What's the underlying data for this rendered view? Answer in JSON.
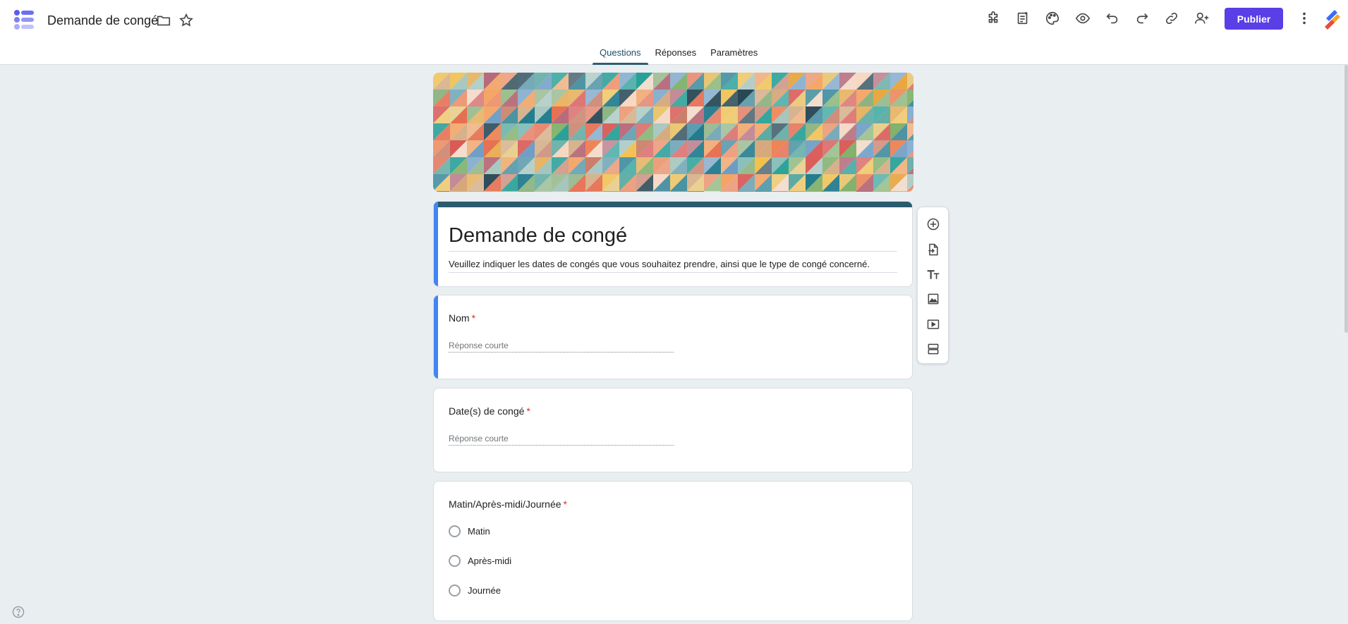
{
  "header": {
    "doc_title": "Demande de congé",
    "publish_label": "Publier"
  },
  "tabs": [
    {
      "label": "Questions",
      "active": true
    },
    {
      "label": "Réponses",
      "active": false
    },
    {
      "label": "Paramètres",
      "active": false
    }
  ],
  "form": {
    "title": "Demande de congé",
    "description": "Veuillez indiquer les dates de congés que vous souhaitez prendre, ainsi que le type de congé concerné."
  },
  "questions": [
    {
      "label": "Nom",
      "required_mark": "*",
      "placeholder": "Réponse courte"
    },
    {
      "label": "Date(s) de congé",
      "required_mark": "*",
      "placeholder": "Réponse courte"
    },
    {
      "label": "Matin/Après-midi/Journée",
      "required_mark": "*",
      "options": [
        "Matin",
        "Après-midi",
        "Journée"
      ]
    }
  ],
  "colors": {
    "accent": "#4285f4",
    "theme": "#2a5a6e",
    "publish": "#5a3ee6",
    "required": "#d93025",
    "background": "#e9eef1"
  },
  "icons": {
    "toolbar": [
      "add-on-icon",
      "sheet-icon",
      "palette-icon",
      "preview-eye-icon",
      "undo-icon",
      "redo-icon",
      "link-icon",
      "add-collaborator-icon",
      "more-vert-icon"
    ],
    "side": [
      "add-question-icon",
      "import-questions-icon",
      "add-title-icon",
      "add-image-icon",
      "add-video-icon",
      "add-section-icon"
    ]
  }
}
